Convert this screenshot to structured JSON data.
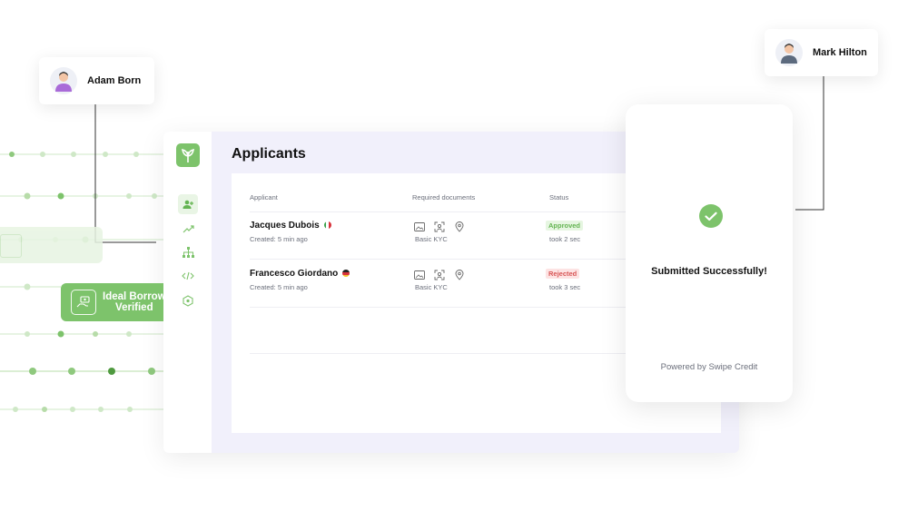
{
  "users": {
    "left_name": "Adam Born",
    "right_name": "Mark Hilton"
  },
  "badge": {
    "line1": "Ideal Borrow",
    "line2": "Verified"
  },
  "dashboard": {
    "title": "Applicants",
    "columns": [
      "Applicant",
      "Required documents",
      "Status"
    ],
    "rows": [
      {
        "name": "Jacques Dubois",
        "flag": "italy",
        "created": "Created: 5 min ago",
        "documents": "Basic KYC",
        "status": "Approved",
        "took": "took 2 sec"
      },
      {
        "name": "Francesco Giordano",
        "flag": "germany",
        "created": "Created: 5 min ago",
        "documents": "Basic KYC",
        "status": "Rejected",
        "took": "took 3 sec"
      }
    ],
    "nav_icons": [
      "users-icon",
      "trend-icon",
      "hierarchy-icon",
      "code-icon",
      "hexagon-icon"
    ]
  },
  "phone": {
    "message": "Submitted Successfully!",
    "powered": "Powered by Swipe Credit"
  },
  "colors": {
    "accent": "#7dc36b",
    "approved": "#64b452",
    "rejected": "#d85757"
  }
}
